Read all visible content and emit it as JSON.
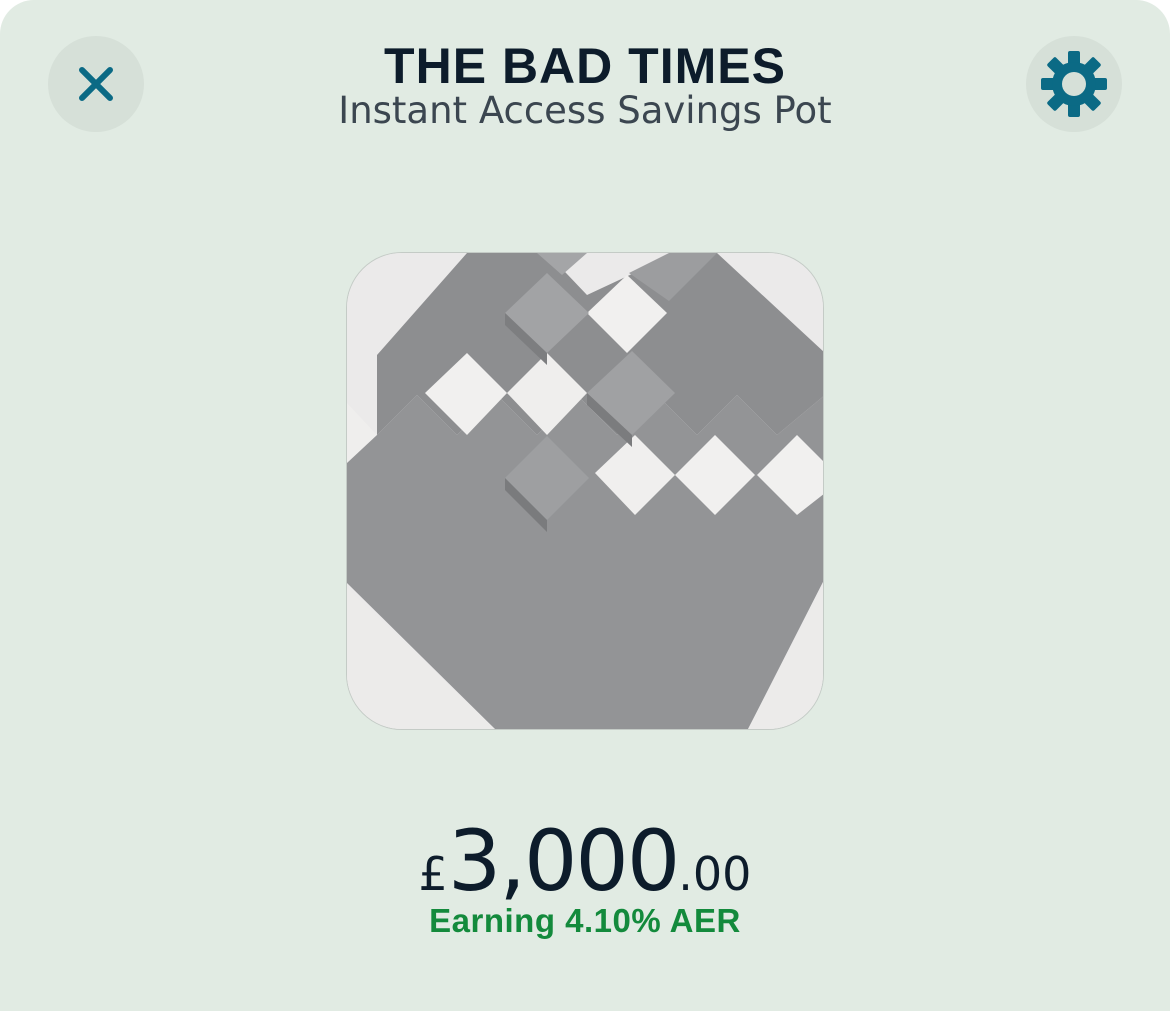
{
  "header": {
    "title": "THE BAD TIMES",
    "subtitle": "Instant Access Savings Pot",
    "close_icon": "close-icon",
    "settings_icon": "gear-icon"
  },
  "pot": {
    "image": "grey-diamond-tiles-artwork"
  },
  "balance": {
    "currency": "£",
    "whole": "3,000",
    "decimal": ".00"
  },
  "rate": {
    "label": "Earning 4.10% AER"
  },
  "colors": {
    "background": "#e1ebe3",
    "accent": "#0b6a85",
    "title": "#0d1c2b",
    "rate": "#138a3c"
  }
}
